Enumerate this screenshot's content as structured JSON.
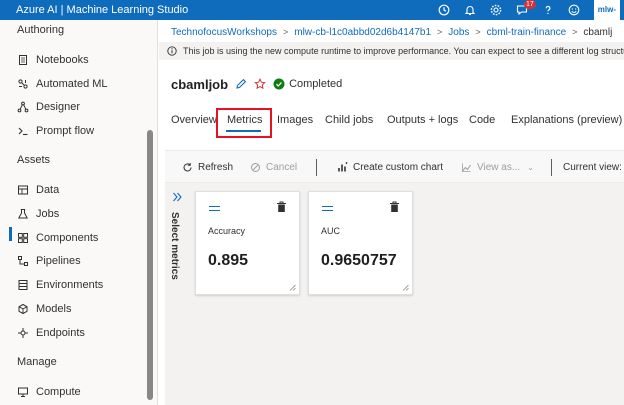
{
  "app": {
    "title": "Azure AI | Machine Learning Studio",
    "notification_count": "17",
    "account_label": "mlw-"
  },
  "sidebar": {
    "sections": [
      {
        "label": "Authoring"
      },
      {
        "label": "Assets"
      },
      {
        "label": "Manage"
      }
    ],
    "items": [
      {
        "label": "Notebooks",
        "icon": "notebook-icon"
      },
      {
        "label": "Automated ML",
        "icon": "automl-icon"
      },
      {
        "label": "Designer",
        "icon": "designer-icon"
      },
      {
        "label": "Prompt flow",
        "icon": "prompt-flow-icon"
      },
      {
        "label": "Data",
        "icon": "data-icon"
      },
      {
        "label": "Jobs",
        "icon": "jobs-icon",
        "active": true
      },
      {
        "label": "Components",
        "icon": "components-icon"
      },
      {
        "label": "Pipelines",
        "icon": "pipelines-icon"
      },
      {
        "label": "Environments",
        "icon": "environments-icon"
      },
      {
        "label": "Models",
        "icon": "models-icon"
      },
      {
        "label": "Endpoints",
        "icon": "endpoints-icon"
      },
      {
        "label": "Compute",
        "icon": "compute-icon"
      }
    ]
  },
  "breadcrumb": [
    {
      "label": "TechnofocusWorkshops"
    },
    {
      "label": "mlw-cb-l1c0abbd02d6b4147b1"
    },
    {
      "label": "Jobs"
    },
    {
      "label": "cbml-train-finance"
    },
    {
      "label": "cbamlj"
    }
  ],
  "infobar": {
    "text": "This job is using the new compute runtime to improve performance. You can expect to see a different log structure a"
  },
  "job": {
    "name": "cbamljob",
    "status": "Completed"
  },
  "tabs": [
    {
      "label": "Overview"
    },
    {
      "label": "Metrics",
      "selected": true
    },
    {
      "label": "Images"
    },
    {
      "label": "Child jobs"
    },
    {
      "label": "Outputs + logs"
    },
    {
      "label": "Code"
    },
    {
      "label": "Explanations (preview)"
    }
  ],
  "toolbar": {
    "refresh": "Refresh",
    "cancel": "Cancel",
    "create_chart": "Create custom chart",
    "view_as": "View as...",
    "current_view": "Current view:"
  },
  "select_metrics_label": "Select metrics",
  "metrics": [
    {
      "name": "Accuracy",
      "value": "0.895"
    },
    {
      "name": "AUC",
      "value": "0.9650757"
    }
  ],
  "colors": {
    "accent": "#0f6cbd",
    "selection_box": "#e81123",
    "status_success": "#107c10"
  }
}
